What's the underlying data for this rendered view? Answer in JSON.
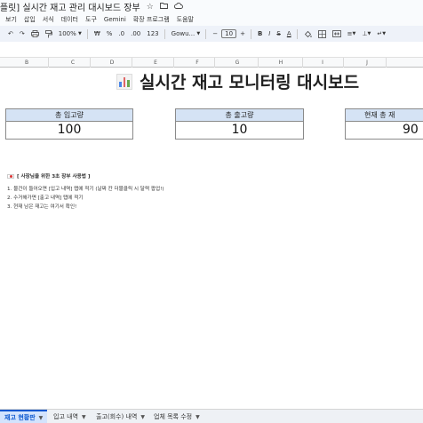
{
  "document": {
    "title": "[플릿] 실시간 재고 관리 대시보드 장부"
  },
  "title_icons": [
    "star-icon",
    "move-to-folder-icon",
    "cloud-status-icon"
  ],
  "menu": [
    "보기",
    "삽입",
    "서식",
    "데이터",
    "도구",
    "Gemini",
    "확장 프로그램",
    "도움말"
  ],
  "toolbar": {
    "zoom": "100%",
    "currency": "₩",
    "percent": "%",
    "decrease_decimal": ".0",
    "increase_decimal": ".00",
    "number_format": "123",
    "font": "Gowu...",
    "font_size": "10",
    "bold": "B",
    "strikethrough": "S",
    "text_color": "A"
  },
  "columns": [
    "B",
    "C",
    "D",
    "E",
    "F",
    "G",
    "H",
    "I",
    "J"
  ],
  "dashboard": {
    "title": "실시간 재고 모니터링 대시보드",
    "cards": [
      {
        "label": "총 입고량",
        "value": "100"
      },
      {
        "label": "총 출고량",
        "value": "10"
      },
      {
        "label": "현재 총 재",
        "value": "90"
      }
    ]
  },
  "guide": {
    "title": "[ 사장님을 위한 3초 장부 사용법 ]",
    "lines": [
      "1. 물건이 들어오면 [입고 내역] 탭에 적기 (날짜 칸 더블클릭 시 달력 팝업!)",
      "2. 수거해가면 [출고 내역] 탭에 적기",
      "3. 현재 남은 재고는 여기서 확인!"
    ]
  },
  "tabs": [
    "재고 현황판",
    "입고 내역",
    "출고(회수) 내역",
    "업체 목록 수정"
  ],
  "colors": {
    "card_header": "#d5e3f5",
    "active_tab": "#d3e3fd",
    "accent": "#0b57d0"
  }
}
